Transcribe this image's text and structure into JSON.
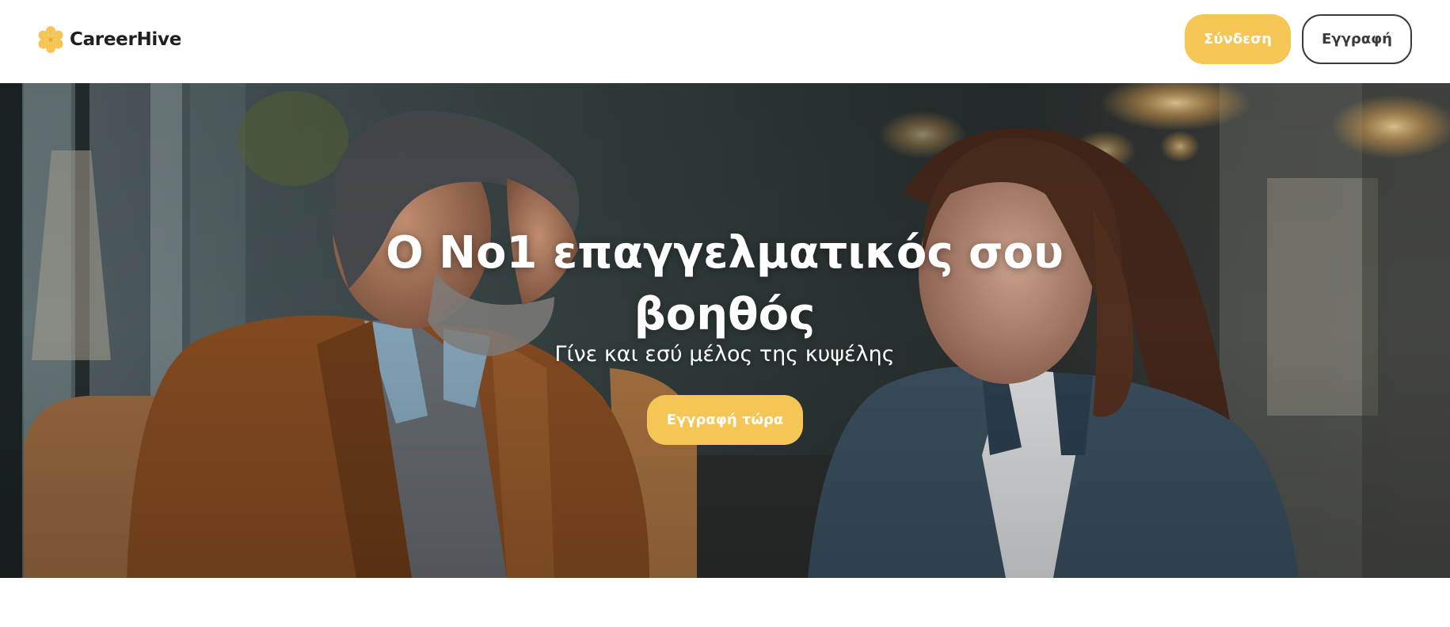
{
  "brand": {
    "name": "CareerHive",
    "logo_icon": "honeycomb-icon",
    "logo_color": "#f5c556"
  },
  "nav": {
    "login_label": "Σύνδεση",
    "register_label": "Εγγραφή"
  },
  "hero": {
    "image": "photo-two-professionals-talking",
    "title": "Ο Νο1 επαγγελματικός σου βοηθός",
    "subtitle": "Γίνε και εσύ μέλος της κυψέλης",
    "cta_label": "Εγγραφή τώρα"
  },
  "colors": {
    "accent": "#f5c556",
    "outline": "#3a3a3a",
    "background": "#ffffff"
  }
}
